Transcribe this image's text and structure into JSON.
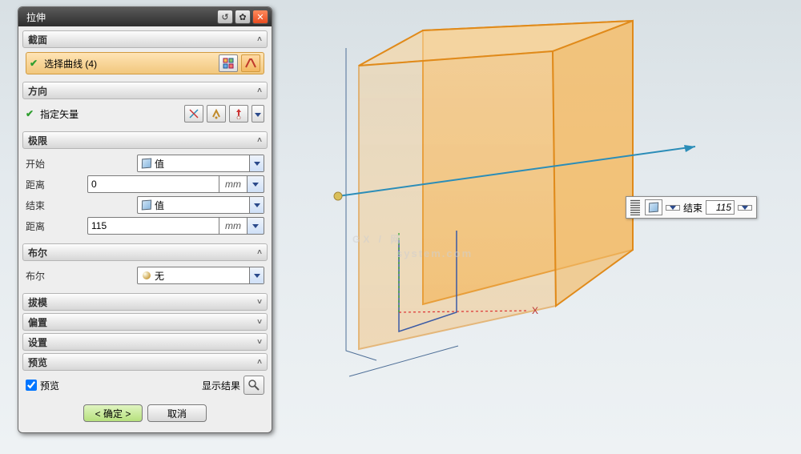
{
  "dialog": {
    "title": "拉伸",
    "sections": {
      "section_profile": "截面",
      "select_curve": "选择曲线 (4)",
      "section_direction": "方向",
      "specify_vector": "指定矢量",
      "section_limits": "极限",
      "start": "开始",
      "start_mode": "值",
      "start_distance_label": "距离",
      "start_distance_value": "0",
      "end": "结束",
      "end_mode": "值",
      "end_distance_label": "距离",
      "end_distance_value": "115",
      "unit": "mm",
      "section_boolean": "布尔",
      "boolean_label": "布尔",
      "boolean_mode": "无",
      "section_draft": "拔模",
      "section_offset": "偏置",
      "section_settings": "设置",
      "section_preview": "预览",
      "preview_check": "预览",
      "show_result": "显示结果"
    },
    "buttons": {
      "ok": "< 确定 >",
      "cancel": "取消"
    }
  },
  "floating": {
    "label": "结束",
    "value": "115"
  },
  "watermark": {
    "big": "GX / 网",
    "small": "system.com"
  }
}
